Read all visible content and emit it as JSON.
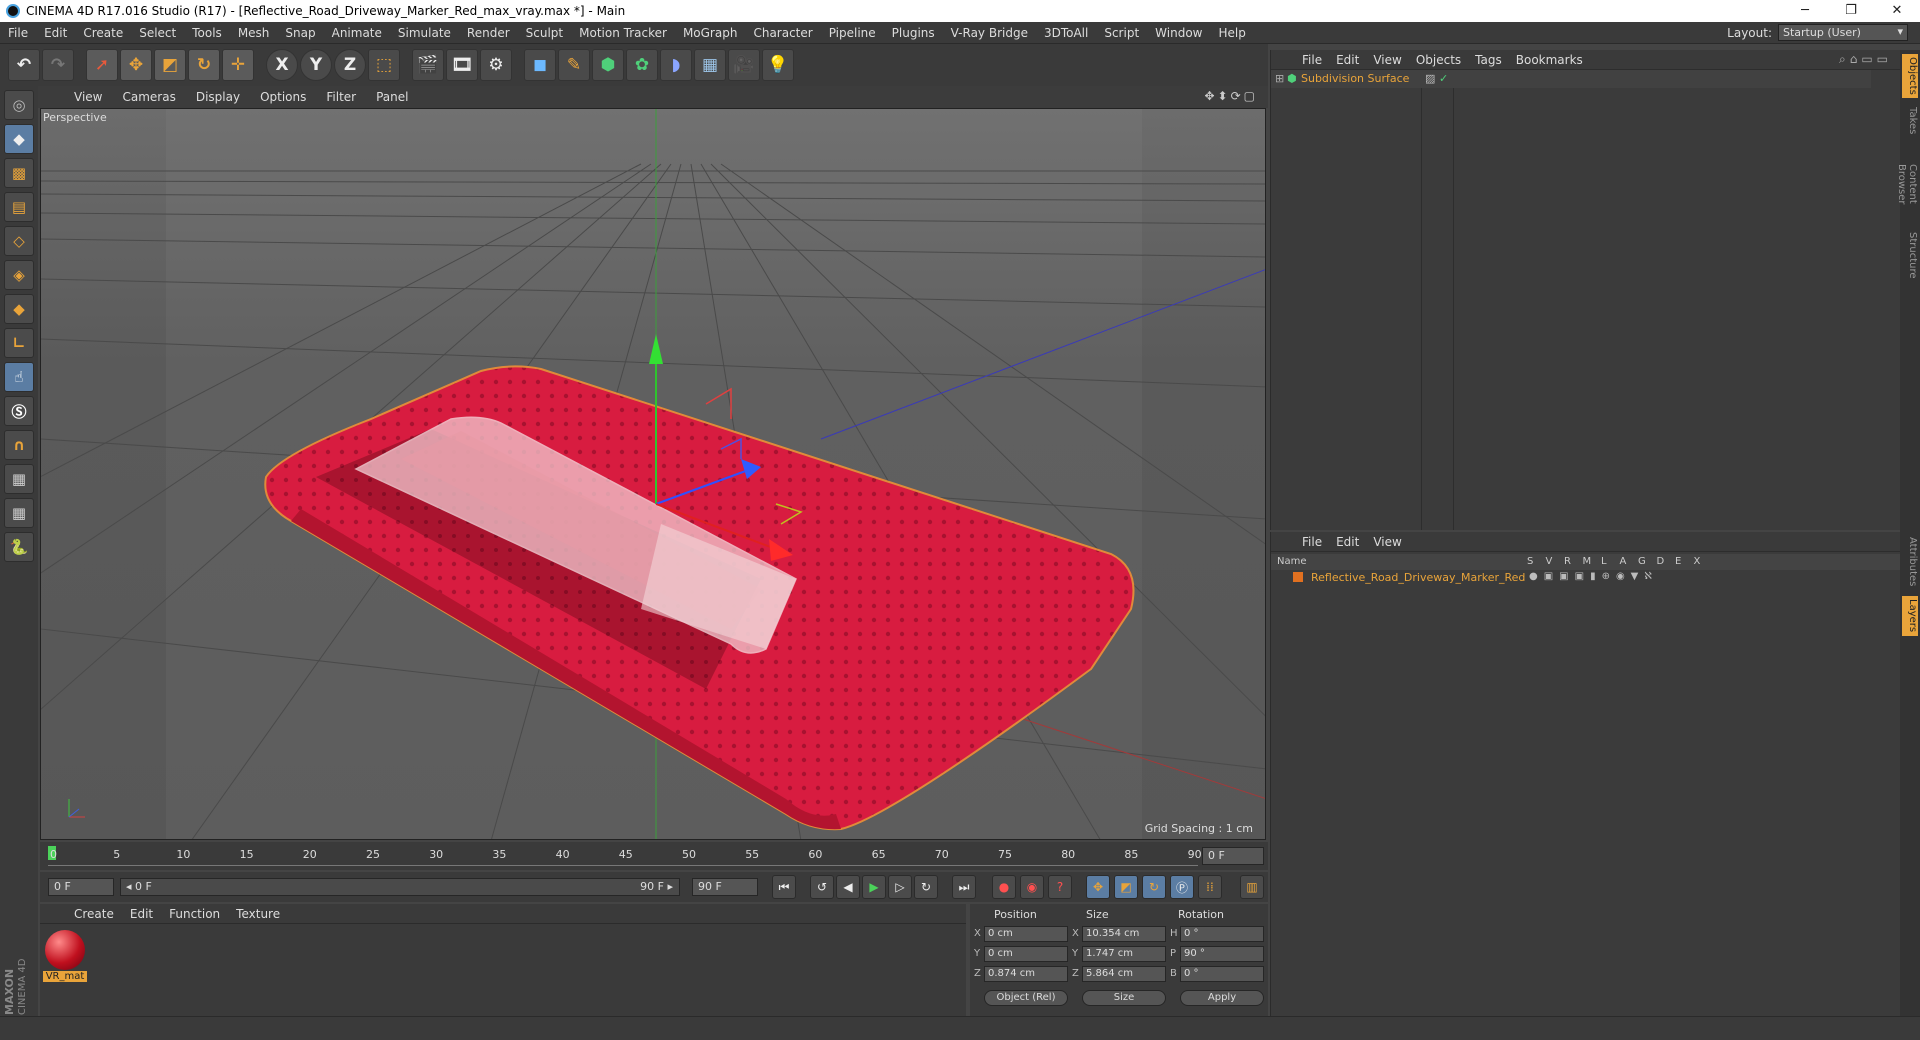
{
  "window": {
    "title": "CINEMA 4D R17.016 Studio (R17) - [Reflective_Road_Driveway_Marker_Red_max_vray.max *] - Main",
    "minimize": "─",
    "restore": "❐",
    "close": "✕"
  },
  "menubar": {
    "items": [
      "File",
      "Edit",
      "Create",
      "Select",
      "Tools",
      "Mesh",
      "Snap",
      "Animate",
      "Simulate",
      "Render",
      "Sculpt",
      "Motion Tracker",
      "MoGraph",
      "Character",
      "Pipeline",
      "Plugins",
      "V-Ray Bridge",
      "3DToAll",
      "Script",
      "Window",
      "Help"
    ],
    "layout_label": "Layout:",
    "layout_value": "Startup (User)"
  },
  "toolbar": {
    "icons": [
      "undo-icon",
      "redo-icon",
      "select-arrow-icon",
      "move-icon",
      "scale-icon",
      "rotate-icon",
      "live-move-icon",
      "x-axis-icon",
      "y-axis-icon",
      "z-axis-icon",
      "coordinate-system-icon",
      "render-view-icon",
      "render-picture-viewer-icon",
      "render-settings-icon",
      "cube-icon",
      "pen-spline-icon",
      "subdivision-icon",
      "array-icon",
      "deformer-icon",
      "floor-icon",
      "camera-icon",
      "light-icon"
    ],
    "axis_labels": [
      "X",
      "Y",
      "Z"
    ]
  },
  "viewport": {
    "menu": [
      "View",
      "Cameras",
      "Display",
      "Options",
      "Filter",
      "Panel"
    ],
    "label": "Perspective",
    "grid_spacing": "Grid Spacing : 1 cm",
    "nav": "✥⬍⟳▢"
  },
  "timeline": {
    "ticks": [
      "0",
      "5",
      "10",
      "15",
      "20",
      "25",
      "30",
      "35",
      "40",
      "45",
      "50",
      "55",
      "60",
      "65",
      "70",
      "75",
      "80",
      "85",
      "90"
    ],
    "current_frame": "0 F"
  },
  "playbar": {
    "start": "0 F",
    "range_start": "◂ 0 F",
    "range_end": "90 F ▸",
    "end": "90 F"
  },
  "material_panel": {
    "menu": [
      "Create",
      "Edit",
      "Function",
      "Texture"
    ],
    "material_name": "VR_mat"
  },
  "coords": {
    "headers": [
      "Position",
      "Size",
      "Rotation"
    ],
    "rows": [
      {
        "axis": "X",
        "pos": "0 cm",
        "size_axis": "X",
        "size": "10.354 cm",
        "rot_axis": "H",
        "rot": "0 °"
      },
      {
        "axis": "Y",
        "pos": "0 cm",
        "size_axis": "Y",
        "size": "1.747 cm",
        "rot_axis": "P",
        "rot": "90 °"
      },
      {
        "axis": "Z",
        "pos": "0.874 cm",
        "size_axis": "Z",
        "size": "5.864 cm",
        "rot_axis": "B",
        "rot": "0 °"
      }
    ],
    "mode": "Object (Rel)",
    "size_mode": "Size",
    "apply": "Apply"
  },
  "object_manager": {
    "menu": [
      "File",
      "Edit",
      "View",
      "Objects",
      "Tags",
      "Bookmarks"
    ],
    "object_name": "Subdivision Surface"
  },
  "layer_manager": {
    "menu": [
      "File",
      "Edit",
      "View"
    ],
    "col_name": "Name",
    "cols": [
      "S",
      "V",
      "R",
      "M",
      "L",
      "A",
      "G",
      "D",
      "E",
      "X"
    ],
    "object_name": "Reflective_Road_Driveway_Marker_Red"
  },
  "side_tabs": [
    "Objects",
    "Takes",
    "Content Browser",
    "Structure",
    "Attributes",
    "Layers"
  ],
  "brand": {
    "line1": "MAXON",
    "line2": "CINEMA 4D"
  },
  "colors": {
    "accent": "#e9a43a",
    "marker_red": "#d4183a",
    "selected_text": "#e9a43a"
  }
}
